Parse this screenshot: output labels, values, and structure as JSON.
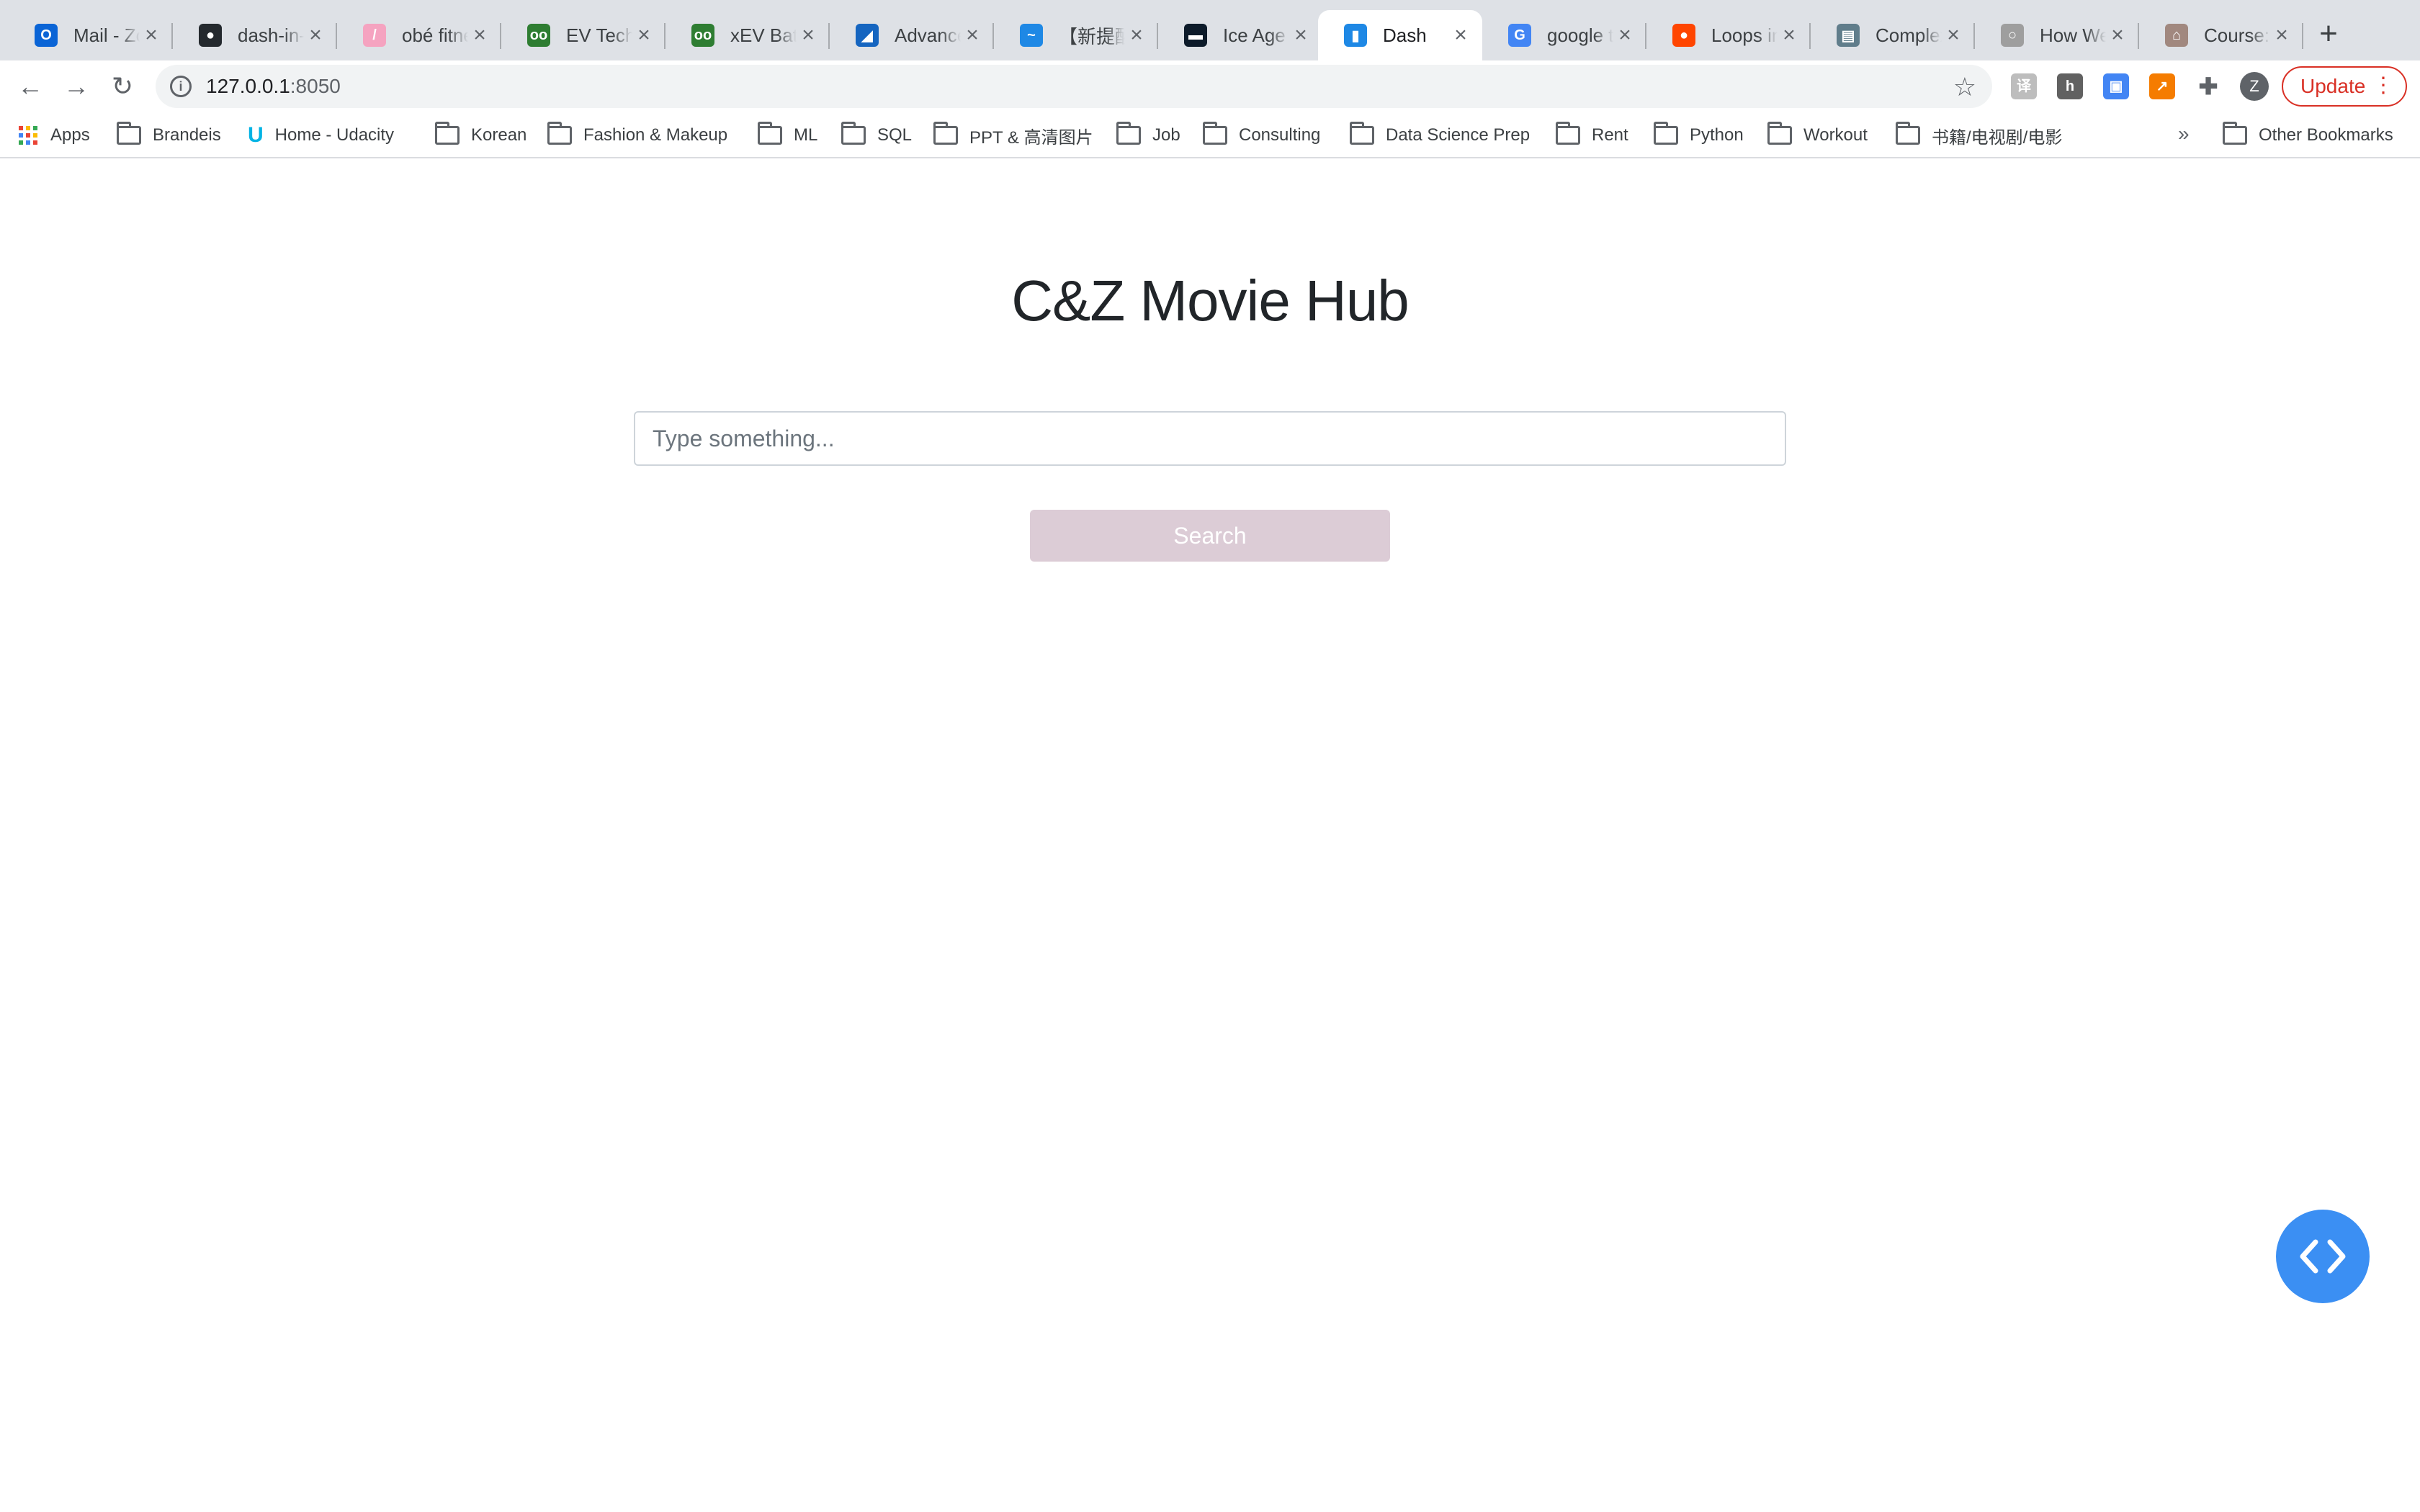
{
  "browser": {
    "tabs": [
      {
        "title": "Mail - Zoe",
        "icon": "outlook-icon",
        "color": "#0a64d6",
        "glyph": "O"
      },
      {
        "title": "dash-in-",
        "icon": "github-icon",
        "color": "#24292e",
        "glyph": "●"
      },
      {
        "title": "obé fitness",
        "icon": "obe-icon",
        "color": "#f5a3c0",
        "glyph": "/"
      },
      {
        "title": "EV Techn",
        "icon": "ev-icon",
        "color": "#2e7d32",
        "glyph": "oo"
      },
      {
        "title": "xEV Batt",
        "icon": "xev-icon",
        "color": "#2e7d32",
        "glyph": "oo"
      },
      {
        "title": "Advance",
        "icon": "advance-icon",
        "color": "#1565c0",
        "glyph": "◢"
      },
      {
        "title": "【新提醒",
        "icon": "bird-icon",
        "color": "#1e88e5",
        "glyph": "~"
      },
      {
        "title": "Ice Age",
        "icon": "iceage-icon",
        "color": "#0d1b2a",
        "glyph": "▬"
      },
      {
        "title": "Dash",
        "icon": "dash-icon",
        "color": "#1e88e5",
        "glyph": "▮"
      },
      {
        "title": "google t",
        "icon": "google-icon",
        "color": "#4285f4",
        "glyph": "G"
      },
      {
        "title": "Loops in",
        "icon": "reddit-icon",
        "color": "#ff4500",
        "glyph": "●"
      },
      {
        "title": "Complex",
        "icon": "complex-icon",
        "color": "#607d8b",
        "glyph": "▤"
      },
      {
        "title": "How We",
        "icon": "howwe-icon",
        "color": "#9e9e9e",
        "glyph": "○"
      },
      {
        "title": "Course:",
        "icon": "course-icon",
        "color": "#a1887f",
        "glyph": "⌂"
      }
    ],
    "active_tab_index": 8,
    "url_host": "127.0.0.1",
    "url_port": ":8050",
    "update_label": "Update",
    "avatar_letter": "Z",
    "bookmarks": [
      {
        "label": "Apps",
        "type": "apps"
      },
      {
        "label": "Brandeis",
        "type": "folder"
      },
      {
        "label": "Home - Udacity",
        "type": "udacity"
      },
      {
        "label": "Korean",
        "type": "folder"
      },
      {
        "label": "Fashion & Makeup",
        "type": "folder"
      },
      {
        "label": "ML",
        "type": "folder"
      },
      {
        "label": "SQL",
        "type": "folder"
      },
      {
        "label": "PPT & 高清图片",
        "type": "folder"
      },
      {
        "label": "Job",
        "type": "folder"
      },
      {
        "label": "Consulting",
        "type": "folder"
      },
      {
        "label": "Data Science Prep",
        "type": "folder"
      },
      {
        "label": "Rent",
        "type": "folder"
      },
      {
        "label": "Python",
        "type": "folder"
      },
      {
        "label": "Workout",
        "type": "folder"
      },
      {
        "label": "书籍/电视剧/电影",
        "type": "folder"
      }
    ],
    "bookmarks_overflow": "»",
    "other_bookmarks": "Other Bookmarks"
  },
  "page": {
    "title": "C&Z Movie Hub",
    "search_placeholder": "Type something...",
    "search_value": "",
    "search_button": "Search",
    "button_color": "#dcccd6",
    "devtools_color": "#3b8ff3"
  }
}
